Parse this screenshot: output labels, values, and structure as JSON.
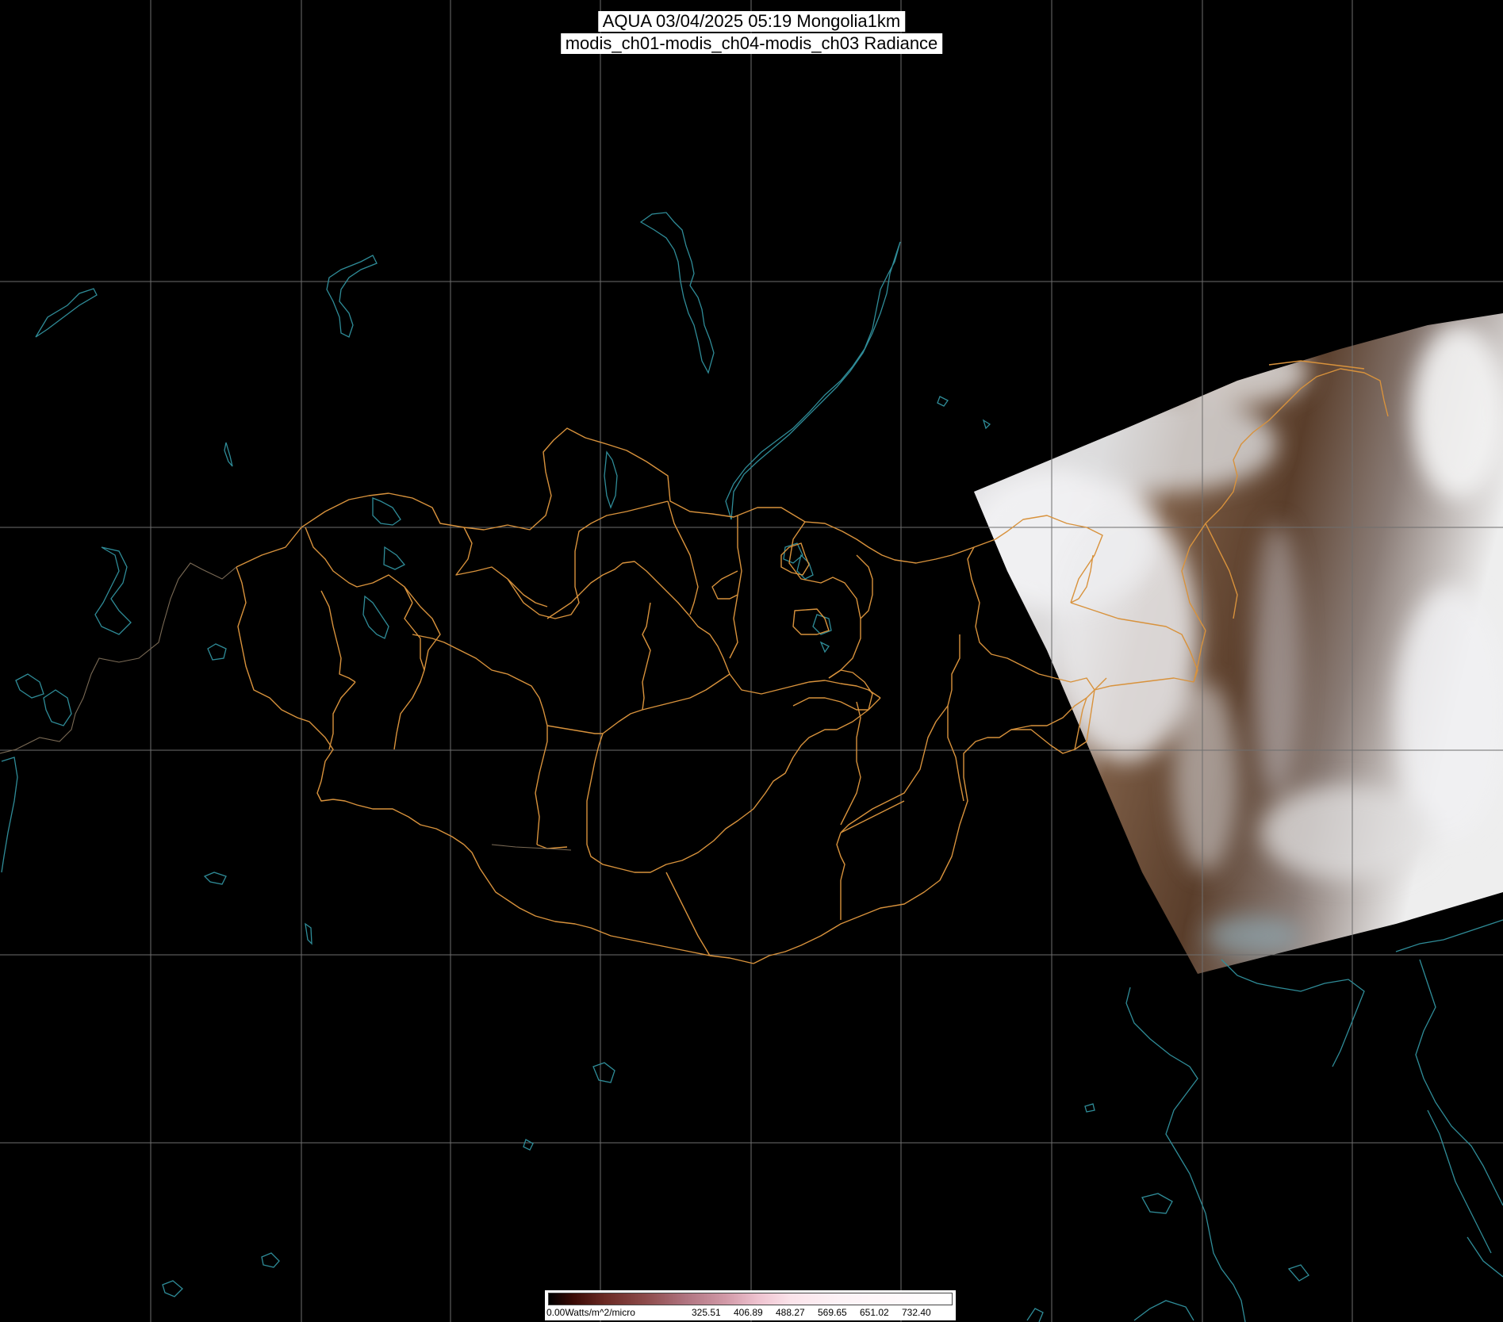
{
  "title": {
    "line1": "AQUA 03/04/2025 05:19 Mongolia1km",
    "line2": "modis_ch01-modis_ch04-modis_ch03 Radiance"
  },
  "colorbar": {
    "min_label": "0.00Watts/m^2/micro",
    "tick_labels": [
      "325.51",
      "406.89",
      "488.27",
      "569.65",
      "651.02",
      "732.40"
    ]
  },
  "colors": {
    "background": "#000000",
    "graticule": "#6e6e6e",
    "admin_borders": "#d8923c",
    "coastlines_lakes": "#2f8c98",
    "clouds_snow": "#e6e6e8",
    "land": "#6a4a30"
  }
}
